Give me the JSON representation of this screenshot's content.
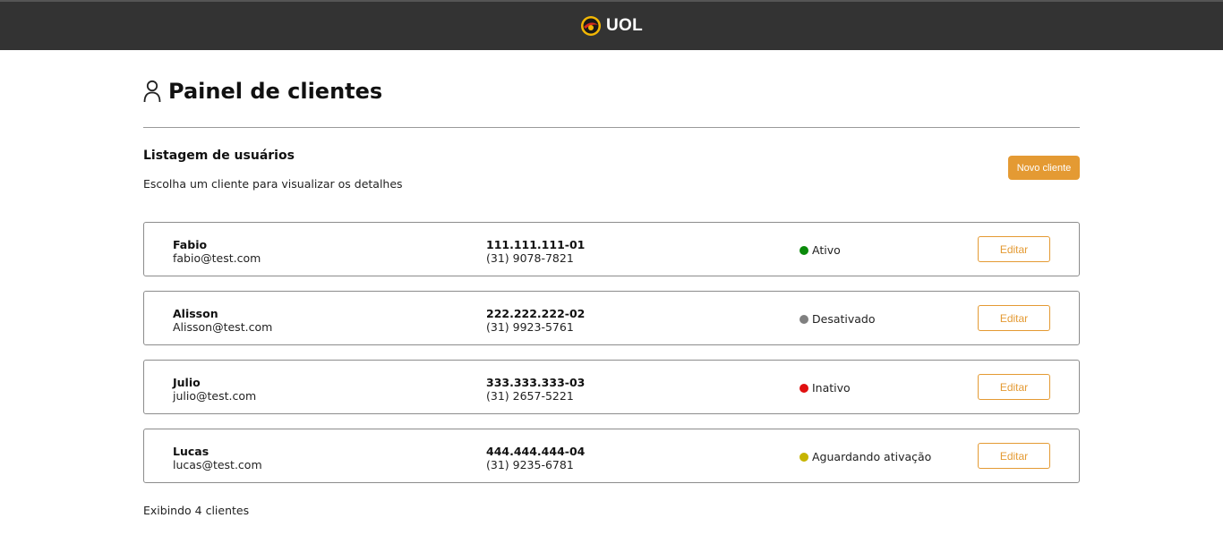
{
  "header": {
    "brand": "UOL",
    "logo_icon": "uol-logo-icon"
  },
  "page": {
    "title": "Painel de clientes",
    "title_icon": "user-icon"
  },
  "section": {
    "title": "Listagem de usuários",
    "subtitle": "Escolha um cliente para visualizar os detalhes",
    "new_button_label": "Novo cliente"
  },
  "colors": {
    "accent": "#e49a33",
    "topbar": "#333333"
  },
  "clients": [
    {
      "name": "Fabio",
      "email": "fabio@test.com",
      "cpf": "111.111.111-01",
      "phone": "(31) 9078-7821",
      "status": "Ativo",
      "status_color": "#0a8a0a",
      "edit_label": "Editar"
    },
    {
      "name": "Alisson",
      "email": "Alisson@test.com",
      "cpf": "222.222.222-02",
      "phone": "(31) 9923-5761",
      "status": "Desativado",
      "status_color": "#808080",
      "edit_label": "Editar"
    },
    {
      "name": "Julio",
      "email": "julio@test.com",
      "cpf": "333.333.333-03",
      "phone": "(31) 2657-5221",
      "status": "Inativo",
      "status_color": "#e01010",
      "edit_label": "Editar"
    },
    {
      "name": "Lucas",
      "email": "lucas@test.com",
      "cpf": "444.444.444-04",
      "phone": "(31) 9235-6781",
      "status": "Aguardando ativação",
      "status_color": "#c6b400",
      "edit_label": "Editar"
    }
  ],
  "footer": {
    "count_text": "Exibindo 4 clientes"
  }
}
